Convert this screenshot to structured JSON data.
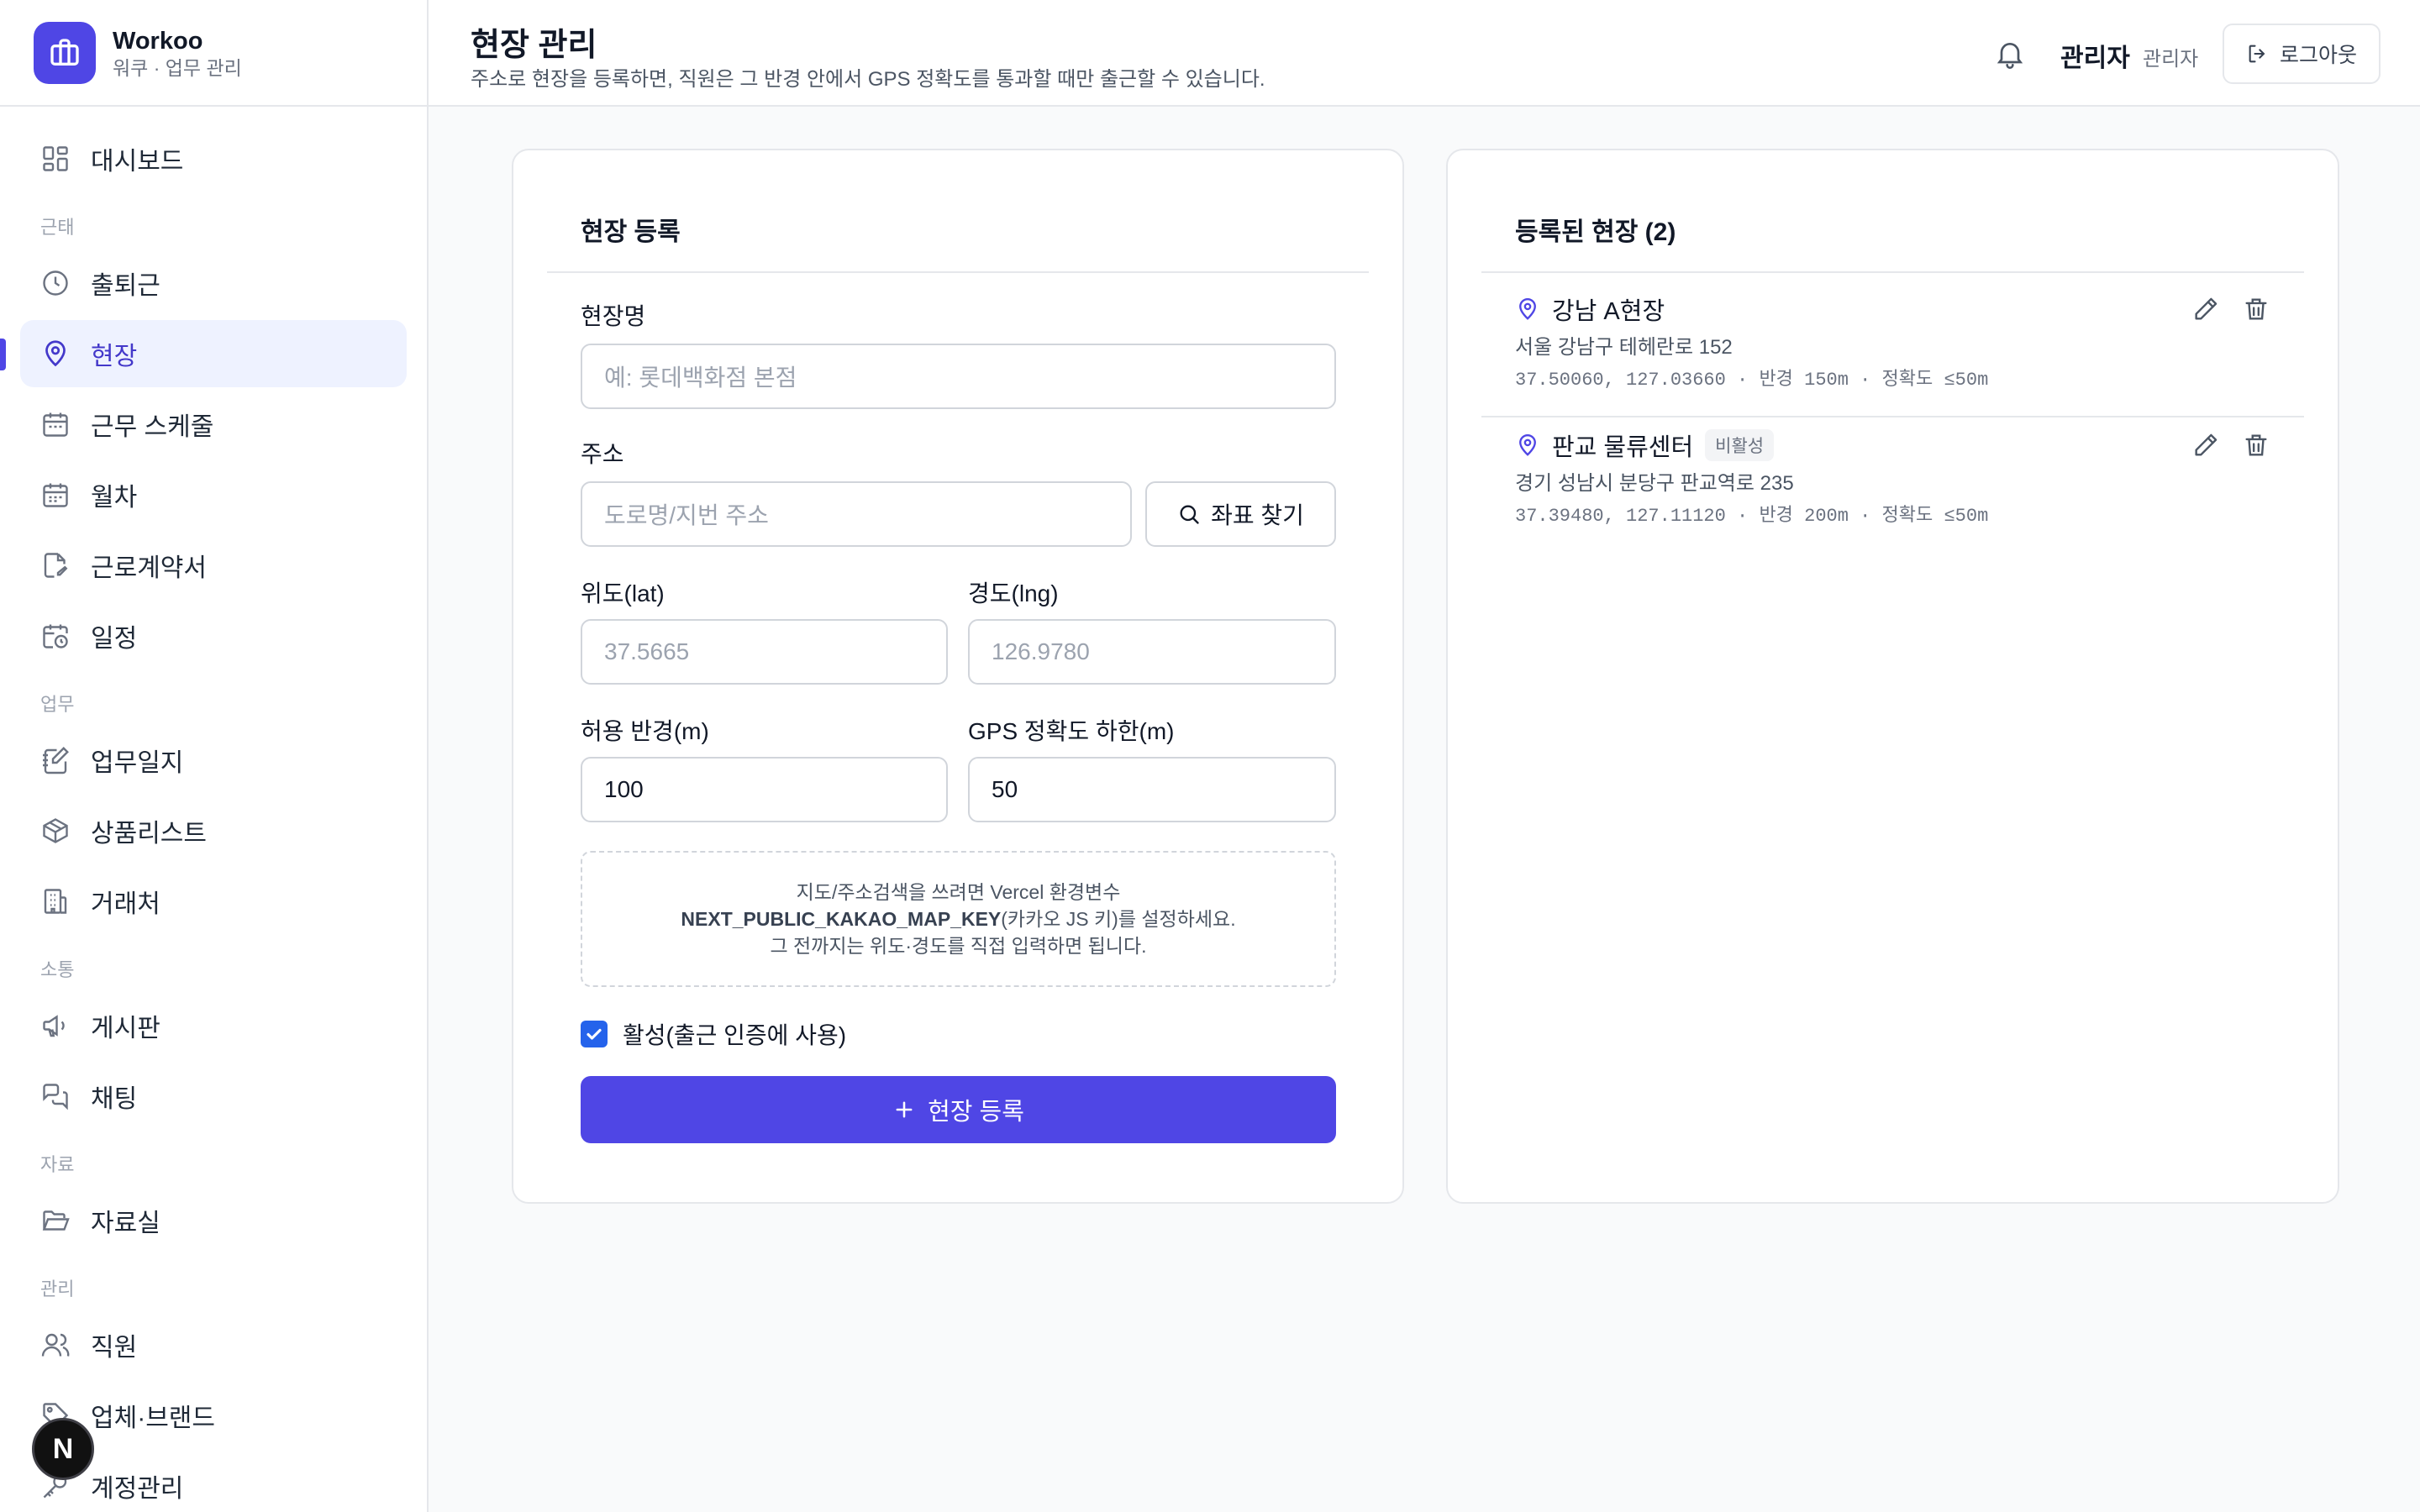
{
  "brand": {
    "name": "Workoo",
    "subtitle": "워쿠 · 업무 관리"
  },
  "sidebar": {
    "items": [
      {
        "label": "대시보드"
      },
      {
        "section": "근태"
      },
      {
        "label": "출퇴근"
      },
      {
        "label": "현장",
        "active": true
      },
      {
        "label": "근무 스케줄"
      },
      {
        "label": "월차"
      },
      {
        "label": "근로계약서"
      },
      {
        "label": "일정"
      },
      {
        "section": "업무"
      },
      {
        "label": "업무일지"
      },
      {
        "label": "상품리스트"
      },
      {
        "label": "거래처"
      },
      {
        "section": "소통"
      },
      {
        "label": "게시판"
      },
      {
        "label": "채팅"
      },
      {
        "section": "자료"
      },
      {
        "label": "자료실"
      },
      {
        "section": "관리"
      },
      {
        "label": "직원"
      },
      {
        "label": "업체·브랜드"
      },
      {
        "label": "계정관리"
      }
    ]
  },
  "header": {
    "title": "현장 관리",
    "description": "주소로 현장을 등록하면, 직원은 그 반경 안에서 GPS 정확도를 통과할 때만 출근할 수 있습니다.",
    "user_name": "관리자",
    "user_role": "관리자",
    "logout_label": "로그아웃"
  },
  "form": {
    "title": "현장 등록",
    "name_label": "현장명",
    "name_placeholder": "예: 롯데백화점 본점",
    "address_label": "주소",
    "address_placeholder": "도로명/지번 주소",
    "search_label": "좌표 찾기",
    "lat_label": "위도(lat)",
    "lat_placeholder": "37.5665",
    "lng_label": "경도(lng)",
    "lng_placeholder": "126.9780",
    "radius_label": "허용 반경(m)",
    "radius_value": "100",
    "gps_label": "GPS 정확도 하한(m)",
    "gps_value": "50",
    "note_line1": "지도/주소검색을 쓰려면 Vercel 환경변수",
    "note_key": "NEXT_PUBLIC_KAKAO_MAP_KEY",
    "note_line2_rest": "(카카오 JS 키)를 설정하세요.",
    "note_line3": "그 전까지는 위도·경도를 직접 입력하면 됩니다.",
    "active_label": "활성(출근 인증에 사용)",
    "active_checked": true,
    "submit_label": "현장 등록"
  },
  "site_list": {
    "title": "등록된 현장 (2)",
    "sites": [
      {
        "name": "강남 A현장",
        "badge": "",
        "address": "서울 강남구 테헤란로 152",
        "meta": "37.50060, 127.03660 · 반경 150m · 정확도 ≤50m"
      },
      {
        "name": "판교 물류센터",
        "badge": "비활성",
        "address": "경기 성남시 분당구 판교역로 235",
        "meta": "37.39480, 127.11120 · 반경 200m · 정확도 ≤50m"
      }
    ]
  },
  "dev_badge": "N",
  "colors": {
    "accent": "#4f46e5",
    "active_bg": "#eef2ff",
    "checkbox": "#2563eb"
  }
}
